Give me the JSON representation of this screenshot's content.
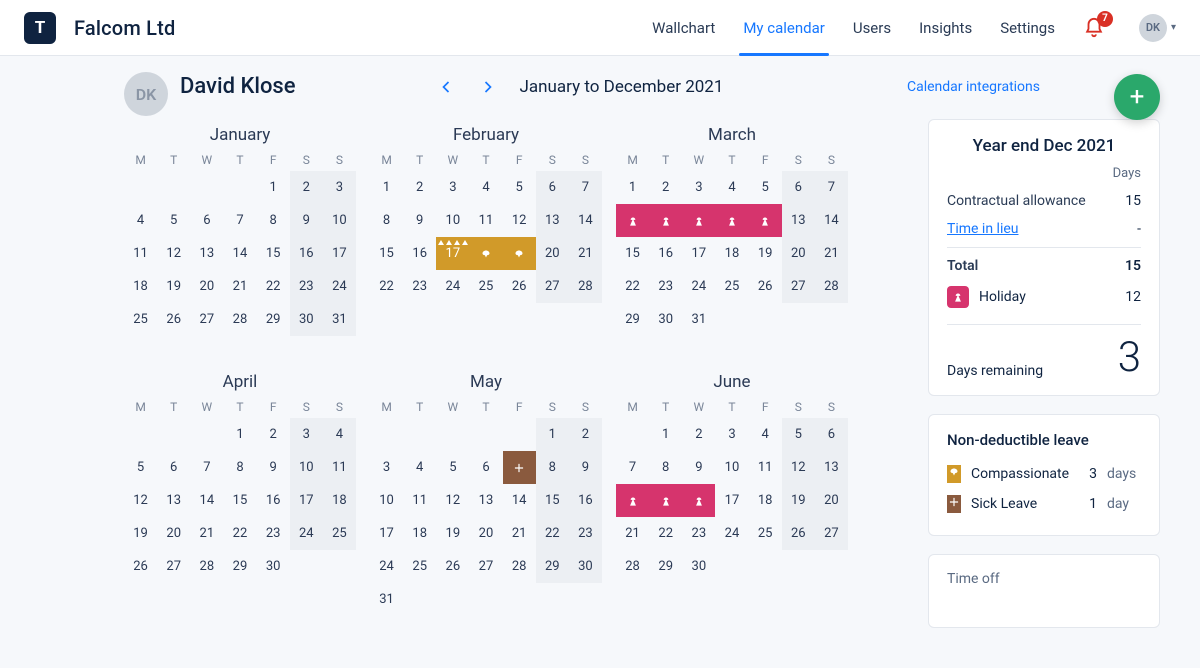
{
  "brand": {
    "logo_letter": "T",
    "company": "Falcom Ltd"
  },
  "nav": {
    "items": [
      "Wallchart",
      "My calendar",
      "Users",
      "Insights",
      "Settings"
    ],
    "active_index": 1,
    "notifications": "7"
  },
  "user": {
    "initials": "DK",
    "name": "David Klose"
  },
  "range": {
    "label": "January to December 2021"
  },
  "links": {
    "integrations": "Calendar integrations"
  },
  "dow": [
    "M",
    "T",
    "W",
    "T",
    "F",
    "S",
    "S"
  ],
  "colors": {
    "holiday": "#d6346d",
    "compassionate": "#d19a29",
    "sick": "#8a5a3e"
  },
  "months": [
    {
      "name": "January",
      "days": 31,
      "first_dow": 5,
      "marks": {}
    },
    {
      "name": "February",
      "days": 28,
      "first_dow": 1,
      "marks": {
        "17": "comp-tri",
        "18": "comp",
        "19": "comp"
      }
    },
    {
      "name": "March",
      "days": 31,
      "first_dow": 1,
      "marks": {
        "8": "holiday",
        "9": "holiday",
        "10": "holiday",
        "11": "holiday",
        "12": "holiday"
      }
    },
    {
      "name": "April",
      "days": 30,
      "first_dow": 4,
      "marks": {}
    },
    {
      "name": "May",
      "days": 31,
      "first_dow": 6,
      "marks": {
        "7": "sick"
      }
    },
    {
      "name": "June",
      "days": 30,
      "first_dow": 2,
      "marks": {
        "14": "holiday",
        "15": "holiday",
        "16": "holiday"
      }
    }
  ],
  "allowance": {
    "title": "Year end Dec 2021",
    "days_label": "Days",
    "rows": [
      {
        "k": "Contractual allowance",
        "v": "15",
        "link": false
      },
      {
        "k": "Time in lieu",
        "v": "-",
        "link": true
      }
    ],
    "total_label": "Total",
    "total_value": "15",
    "types": [
      {
        "name": "Holiday",
        "style": "hol",
        "v": "12"
      }
    ],
    "remaining_label": "Days remaining",
    "remaining_value": "3"
  },
  "nondeduct": {
    "heading": "Non-deductible leave",
    "rows": [
      {
        "name": "Compassionate",
        "style": "comp",
        "v": "3",
        "unit": "days"
      },
      {
        "name": "Sick Leave",
        "style": "sick",
        "v": "1",
        "unit": "day"
      }
    ]
  },
  "timeoff": {
    "heading": "Time off"
  }
}
